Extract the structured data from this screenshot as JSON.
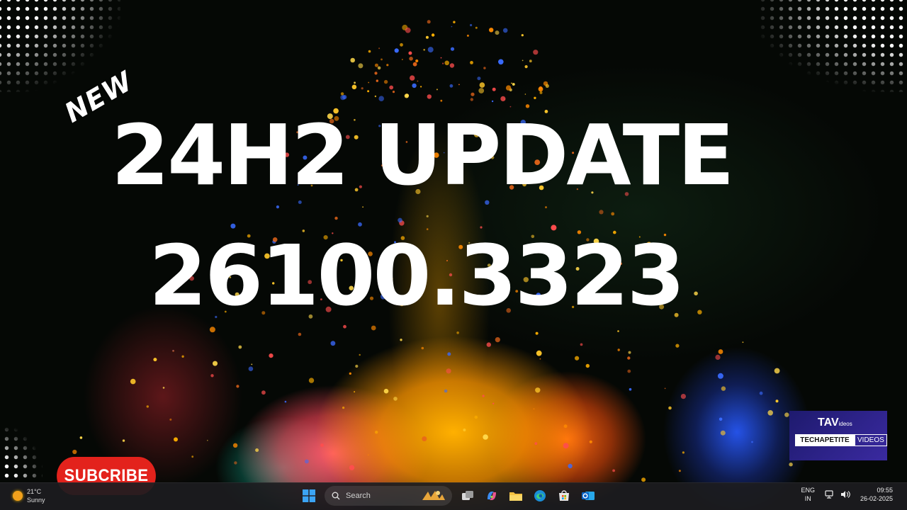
{
  "overlay": {
    "badge_text": "NEW",
    "headline_line1": "24H2 UPDATE",
    "headline_line2": "26100.3323",
    "subscribe_label": "SUBCRIBE",
    "brand": {
      "top_mark": "TAV",
      "top_small": "ideos",
      "left_label": "TECHAPETITE",
      "right_label": "VIDEOS"
    }
  },
  "taskbar": {
    "weather": {
      "temperature": "21°C",
      "condition": "Sunny"
    },
    "search_placeholder": "Search",
    "pinned_icons": [
      "windows-start-icon",
      "task-view-icon",
      "copilot-icon",
      "file-explorer-icon",
      "edge-icon",
      "microsoft-store-icon",
      "outlook-icon"
    ],
    "tray": {
      "language_line1": "ENG",
      "language_line2": "IN",
      "time": "09:55",
      "date": "26-02-2025"
    }
  },
  "colors": {
    "subscribe_red": "#e3221c",
    "brand_purple": "#2a2290",
    "taskbar_bg": "#1c1c20",
    "accent_orange": "#ffb000"
  }
}
